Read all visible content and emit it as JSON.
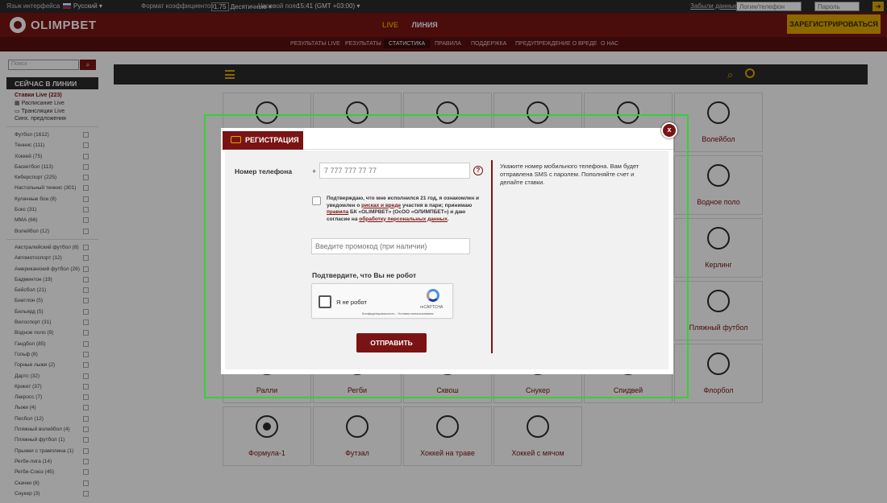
{
  "topbar": {
    "language_label": "Язык интерфейса",
    "language_value": "Русский",
    "odds_label": "Формат коэффициентов",
    "odds_sample": "1.75",
    "odds_value": "Десятичные",
    "timezone_label": "Часовой пояс",
    "timezone_value": "15:41 (GMT +03:00)",
    "forgot_label": "Забыли данные?",
    "login_placeholder": "Логин/телефон",
    "password_placeholder": "Пароль"
  },
  "header": {
    "logo_text": "OLIMPBET",
    "nav_live": "LIVE",
    "nav_line": "ЛИНИЯ",
    "register_label": "ЗАРЕГИСТРИРОВАТЬСЯ"
  },
  "subnav": {
    "items": [
      "РЕЗУЛЬТАТЫ LIVE",
      "РЕЗУЛЬТАТЫ",
      "СТАТИСТИКА",
      "ПРАВИЛА",
      "ПОДДЕРЖКА",
      "ПРЕДУПРЕЖДЕНИЕ О ВРЕДЕ",
      "О НАС"
    ],
    "active_index": 2
  },
  "sidebar": {
    "search_placeholder": "Поиск",
    "title": "СЕЙЧАС В ЛИНИИ",
    "live_stakes": "Ставки Live (223)",
    "live_schedule": "Расписание Live",
    "live_streams": "Трансляции Live",
    "sync": "Синх. предложения",
    "sports_top": [
      "Футбол (1612)",
      "Теннис (111)",
      "Хоккей (75)",
      "Баскетбол (113)",
      "Киберспорт (225)",
      "Настольный теннис (301)",
      "Кулачные бои (8)",
      "Бокс (31)",
      "ММА (66)",
      "Волейбол (12)"
    ],
    "sports_rest": [
      "Австралийский футбол (8)",
      "Автомотоспорт (12)",
      "Американский футбол (26)",
      "Бадминтон (19)",
      "Бейсбол (21)",
      "Биатлон (5)",
      "Бильярд (5)",
      "Велоспорт (31)",
      "Водное поло (9)",
      "Гандбол (85)",
      "Гольф (8)",
      "Горные лыжи (2)",
      "Дартс (32)",
      "Крикет (37)",
      "Лакросс (7)",
      "Лыжи (4)",
      "Песбол (12)",
      "Пляжный волейбол (4)",
      "Пляжный футбол (1)",
      "Прыжки с трамплина (1)",
      "Регби-лига (14)",
      "Регби-Союз (45)",
      "Скачки (8)",
      "Снукер (3)"
    ]
  },
  "tiles": {
    "row1_right": "Волейбол",
    "row2_right": "Водное поло",
    "row3_right": "Керлинг",
    "row4_right": "Пляжный футбол",
    "row5": [
      "Ралли",
      "Регби",
      "Сквош",
      "Снукер",
      "Спидвей",
      "Флорбол"
    ],
    "row6": [
      "Формула-1",
      "Футзал",
      "Хоккей на траве",
      "Хоккей с мячом"
    ]
  },
  "modal": {
    "tab_label": "РЕГИСТРАЦИЯ",
    "close_label": "x",
    "phone_label": "Номер телефона",
    "phone_prefix": "+",
    "phone_placeholder": "7 777 777 77 77",
    "help_label": "?",
    "agree_text_1": "Подтверждаю, что мне исполнился 21 год, я ознакомлен и уведомлен о ",
    "agree_link_1": "рисках и вреде",
    "agree_text_2": " участия в пари; принимаю ",
    "agree_link_2": "правила",
    "agree_text_3": " БК «OLIMPBET» (ОсОО «ОЛИМПБЕТ») и даю согласие на ",
    "agree_link_3": "обработку персональных данных",
    "agree_text_4": ".",
    "promo_placeholder": "Введите промокод (при наличии)",
    "robot_title": "Подтвердите, что Вы не робот",
    "captcha_label": "Я не робот",
    "captcha_brand": "reCAPTCHA",
    "captcha_terms": "Конфиденциальность - Условия использования",
    "submit_label": "ОТПРАВИТЬ",
    "hint_text": "Укажите номер мобильного телефона. Вам будет отправлена SMS с паролем. Пополняйте счет и делайте ставки."
  }
}
